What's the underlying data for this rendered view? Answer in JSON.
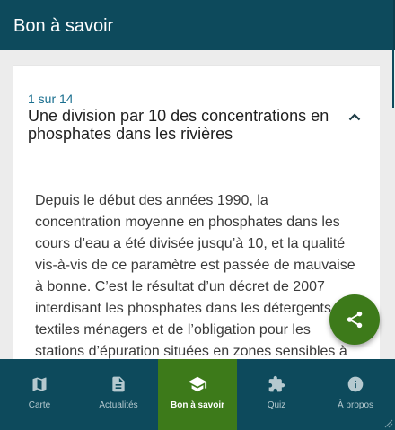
{
  "appbar": {
    "title": "Bon à savoir"
  },
  "card": {
    "counter": "1 sur 14",
    "title": "Une division par 10 des concentrations en phosphates dans les rivières",
    "body": "Depuis le début des années 1990, la concentration moyenne en phosphates dans les cours d’eau a été divisée jusqu’à 10, et la qualité vis-à-vis de ce paramètre est passée de mauvaise à bonne. C’est le résultat d’un décret de 2007 interdisant les phosphates dans les détergents textiles ménagers et de l’obligation pour les stations d’épuration situées en zones sensibles à"
  },
  "fab": {
    "icon": "share-icon"
  },
  "bottom_nav": {
    "items": [
      {
        "label": "Carte",
        "icon": "map-icon"
      },
      {
        "label": "Actualités",
        "icon": "article-icon"
      },
      {
        "label": "Bon à savoir",
        "icon": "school-icon",
        "active": true
      },
      {
        "label": "Quiz",
        "icon": "puzzle-icon"
      },
      {
        "label": "À propos",
        "icon": "info-icon"
      }
    ]
  },
  "colors": {
    "primary": "#0d4a5c",
    "accent_green": "#3d7a1a",
    "counter_text": "#1a6f8f",
    "background": "#ececec"
  }
}
